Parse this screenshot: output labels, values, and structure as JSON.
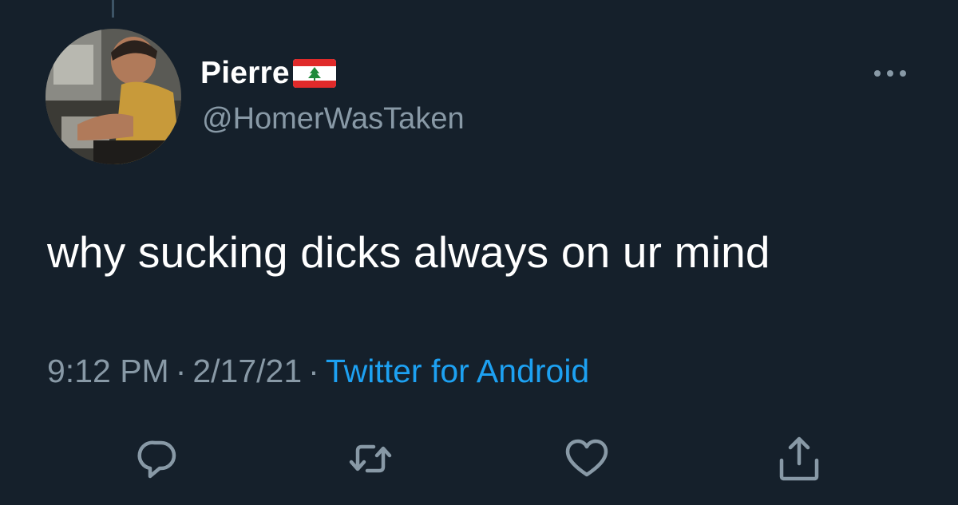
{
  "tweet": {
    "author": {
      "display_name": "Pierre",
      "handle": "@HomerWasTaken",
      "flag_icon": "lebanon-flag-icon",
      "avatar": "profile-photo"
    },
    "text": "why sucking dicks always on ur mind",
    "time": "9:12 PM",
    "date": "2/17/21",
    "separator": "·",
    "source": "Twitter for Android",
    "more_icon": "more-options-icon"
  },
  "actions": [
    {
      "name": "reply",
      "icon": "reply-icon"
    },
    {
      "name": "retweet",
      "icon": "retweet-icon"
    },
    {
      "name": "like",
      "icon": "like-icon"
    },
    {
      "name": "share",
      "icon": "share-icon"
    }
  ],
  "colors": {
    "background": "#15202b",
    "primary_text": "#ffffff",
    "secondary_text": "#8899a6",
    "link": "#1da1f2",
    "icon": "#8899a6"
  }
}
